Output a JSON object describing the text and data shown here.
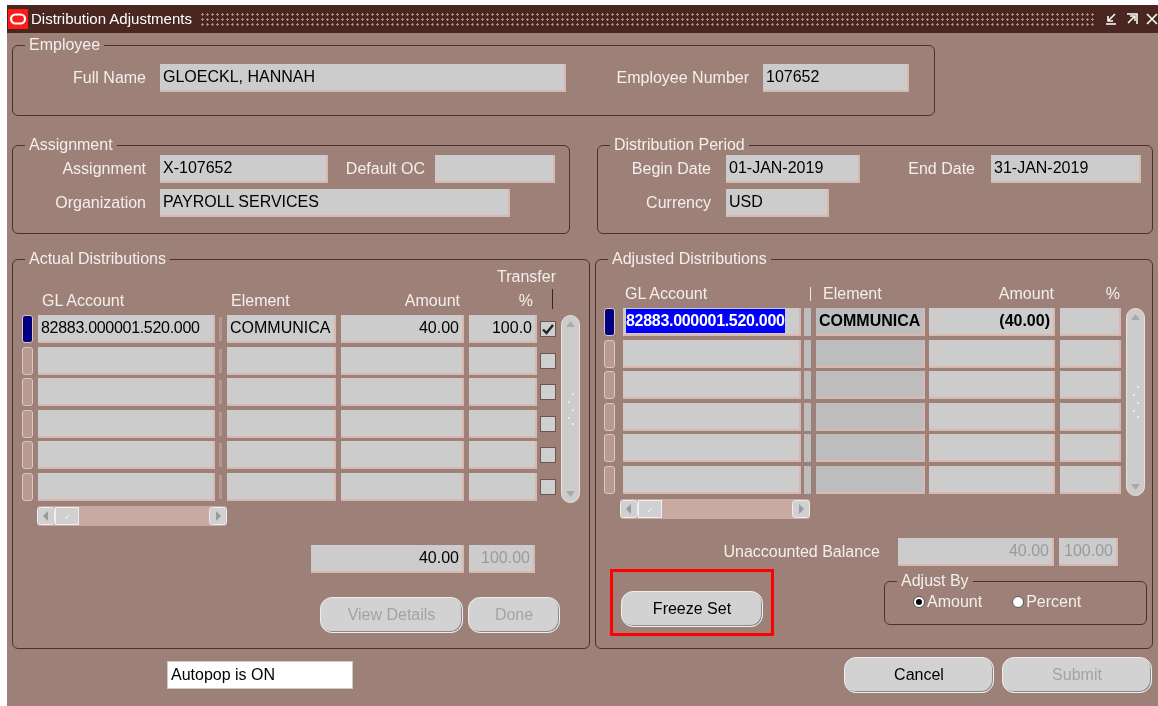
{
  "window": {
    "title": "Distribution Adjustments"
  },
  "employee": {
    "title": "Employee",
    "fields": [
      {
        "label": "Full Name",
        "value": "GLOECKL, HANNAH"
      },
      {
        "label": "Employee Number",
        "value": "107652"
      }
    ]
  },
  "assignment": {
    "title": "Assignment",
    "fields": [
      {
        "label": "Assignment",
        "value": "X-107652"
      },
      {
        "label": "Default OC"
      },
      {
        "label": "Organization",
        "value": "PAYROLL SERVICES"
      }
    ]
  },
  "distribution_period": {
    "title": "Distribution Period",
    "fields": [
      {
        "label": "Begin Date",
        "value": "01-JAN-2019"
      },
      {
        "label": "End Date",
        "value": "31-JAN-2019"
      },
      {
        "label": "Currency",
        "value": "USD"
      }
    ]
  },
  "actual_distributions": {
    "title": "Actual Distributions",
    "transfer_label": "Transfer",
    "columns": [
      "GL Account",
      "Element",
      "Amount",
      "%"
    ],
    "rows": [
      {
        "current": true,
        "transfer": true,
        "gl_account": "82883.000001.520.000",
        "element": "COMMUNICA",
        "amount": "40.00",
        "percent": "100.0"
      },
      {
        "current": false,
        "transfer": false
      },
      {
        "current": false,
        "transfer": false
      },
      {
        "current": false,
        "transfer": false
      },
      {
        "current": false,
        "transfer": false
      },
      {
        "current": false,
        "transfer": false
      }
    ],
    "totals": [
      {
        "value": "40.00",
        "disabled": false
      },
      {
        "value": "100.00",
        "disabled": true
      }
    ],
    "buttons": [
      {
        "label": "View Details",
        "disabled": true
      },
      {
        "label": "Done",
        "disabled": true
      }
    ]
  },
  "adjusted_distributions": {
    "title": "Adjusted Distributions",
    "columns": [
      "GL Account",
      "Element",
      "Amount",
      "%"
    ],
    "rows": [
      {
        "current": true,
        "text_selected": true,
        "gl_account": "82883.000001.520.000",
        "element": "COMMUNICA",
        "amount": "(40.00)"
      },
      {
        "current": false
      },
      {
        "current": false
      },
      {
        "current": false
      },
      {
        "current": false
      },
      {
        "current": false
      }
    ],
    "balance_label": "Unaccounted Balance",
    "balance": [
      {
        "value": "40.00",
        "disabled": true
      },
      {
        "value": "100.00",
        "disabled": true
      }
    ],
    "freeze_button": {
      "label": "Freeze Set",
      "highlighted": true
    },
    "adjust_by": {
      "title": "Adjust By",
      "options": [
        {
          "label": "Amount",
          "selected": true
        },
        {
          "label": "Percent",
          "selected": false
        }
      ]
    }
  },
  "footer": {
    "autopop": "Autopop is ON",
    "buttons": [
      {
        "label": "Cancel",
        "disabled": false
      },
      {
        "label": "Submit",
        "disabled": true
      }
    ]
  }
}
